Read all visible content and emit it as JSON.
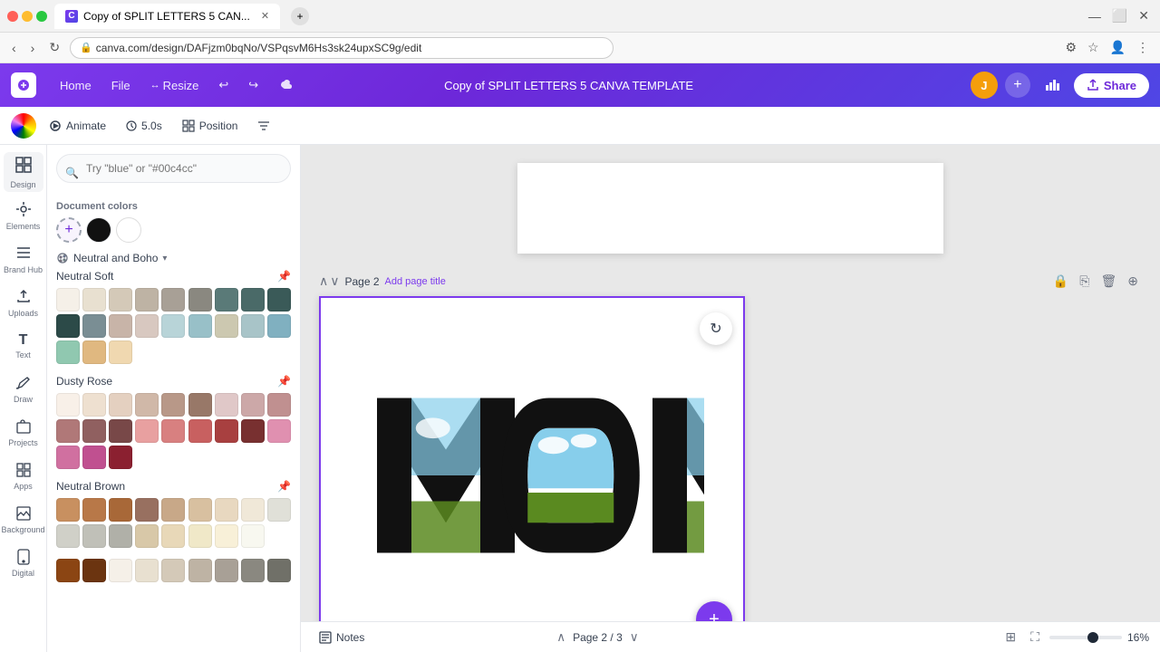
{
  "browser": {
    "tab_title": "Copy of SPLIT LETTERS 5 CAN...",
    "url": "canva.com/design/DAFjzm0bqNo/VSPqsvM6Hs3sk24upxSC9g/edit",
    "favicon": "C"
  },
  "app": {
    "title": "Copy of SPLIT LETTERS 5 CANVA TEMPLATE",
    "home_label": "Home",
    "file_label": "File",
    "resize_label": "Resize",
    "undo_label": "↩",
    "redo_label": "↪",
    "cloud_label": "☁",
    "share_label": "Share",
    "avatar_initials": "J"
  },
  "toolbar": {
    "animate_label": "Animate",
    "duration_label": "5.0s",
    "position_label": "Position",
    "filter_icon": "🎛"
  },
  "sidebar": {
    "items": [
      {
        "id": "design",
        "label": "Design",
        "icon": "⊞"
      },
      {
        "id": "elements",
        "label": "Elements",
        "icon": "◈"
      },
      {
        "id": "brand-hub",
        "label": "Brand Hub",
        "icon": "🏷"
      },
      {
        "id": "uploads",
        "label": "Uploads",
        "icon": "⬆"
      },
      {
        "id": "text",
        "label": "Text",
        "icon": "T"
      },
      {
        "id": "draw",
        "label": "Draw",
        "icon": "✏"
      },
      {
        "id": "projects",
        "label": "Projects",
        "icon": "📁"
      },
      {
        "id": "apps",
        "label": "Apps",
        "icon": "⊞"
      },
      {
        "id": "background",
        "label": "Background",
        "icon": "🖼"
      },
      {
        "id": "digital",
        "label": "Digital",
        "icon": "📱"
      }
    ]
  },
  "color_panel": {
    "search_placeholder": "Try \"blue\" or \"#00c4cc\"",
    "document_colors_label": "Document colors",
    "doc_colors": [
      {
        "color": "#6B2D8B",
        "label": "Purple"
      },
      {
        "color": "#111111",
        "label": "Black"
      },
      {
        "color": "#FFFFFF",
        "label": "White"
      }
    ],
    "palette_selector": {
      "name": "Neutral and Boho",
      "has_dropdown": true
    },
    "palettes": [
      {
        "id": "neutral-soft",
        "name": "Neutral Soft",
        "pin": true,
        "colors": [
          "#F5F0E8",
          "#E8E0D0",
          "#D4C9B8",
          "#BEB3A4",
          "#A8A096",
          "#8A8880",
          "#5A7A78",
          "#4A6A68",
          "#3A5A58",
          "#2C4A48",
          "#7A8E94",
          "#C8B4A8",
          "#D8C8C0",
          "#B8D4D8",
          "#98C0C8",
          "#CCC8B0",
          "#A8C4C8",
          "#80B0C0",
          "#90C8B0",
          "#E0B880",
          "#F0D8B0"
        ]
      },
      {
        "id": "dusty-rose",
        "name": "Dusty Rose",
        "pin": true,
        "colors": [
          "#F8F0E8",
          "#EEE0D0",
          "#E4D0C0",
          "#D0B8A8",
          "#B89888",
          "#987868",
          "#E0C8C8",
          "#CCA8A8",
          "#C09090",
          "#B07878",
          "#906060",
          "#784848",
          "#E8A0A0",
          "#D88080",
          "#C86060",
          "#A84040",
          "#783030",
          "#E090B0",
          "#D070A0",
          "#C05090",
          "#8B2030"
        ]
      },
      {
        "id": "neutral-brown",
        "name": "Neutral Brown",
        "pin": true,
        "colors": [
          "#C89060",
          "#B87848",
          "#A86838",
          "#987060",
          "#C8A888",
          "#D8C0A0",
          "#E8D8C0",
          "#F0E8D8",
          "#E0E0D8",
          "#D0D0C8",
          "#C0C0B8",
          "#B0B0A8",
          "#D8C8A8",
          "#E8D8B8",
          "#F0E8C8",
          "#F8F0D8",
          "#F8F8F0"
        ]
      }
    ]
  },
  "canvas": {
    "page1": {
      "background": "#FFFFFF"
    },
    "page2": {
      "label": "Page 2",
      "add_title": "Add page title",
      "background": "#FFFFFF",
      "text": "MOM"
    }
  },
  "bottom_bar": {
    "notes_icon": "📝",
    "notes_label": "Notes",
    "page_info": "Page 2 / 3",
    "zoom_level": "16%"
  }
}
